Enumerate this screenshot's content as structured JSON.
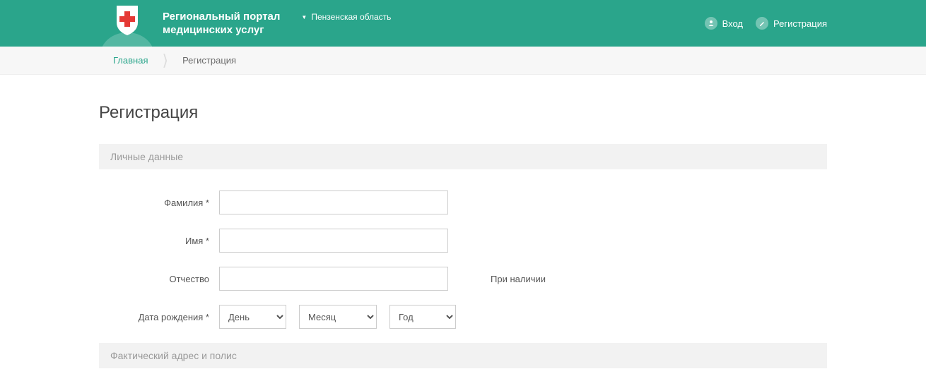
{
  "header": {
    "title_line1": "Региональный портал",
    "title_line2": "медицинских услуг",
    "region": "Пензенская область",
    "login": "Вход",
    "register": "Регистрация"
  },
  "breadcrumb": {
    "home": "Главная",
    "current": "Регистрация"
  },
  "page": {
    "title": "Регистрация",
    "section1": "Личные данные",
    "section2": "Фактический адрес и полис",
    "lastname_label": "Фамилия *",
    "firstname_label": "Имя *",
    "patronymic_label": "Отчество",
    "patronymic_hint": "При наличии",
    "birthdate_label": "Дата рождения *",
    "day": "День",
    "month": "Месяц",
    "year": "Год"
  }
}
